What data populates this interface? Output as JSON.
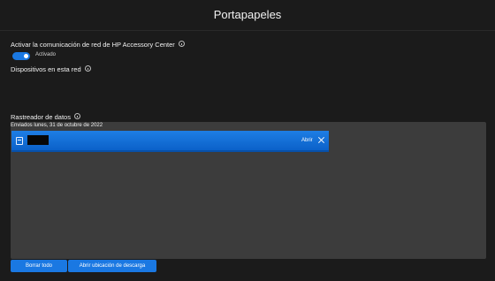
{
  "header": {
    "title": "Portapapeles"
  },
  "network": {
    "label": "Activar la comunicación de red de HP Accessory Center",
    "toggle_state": "Activado",
    "toggle_on": true
  },
  "devices": {
    "label": "Dispositivos en esta red"
  },
  "tracker": {
    "label": "Rastreador de datos",
    "sent_date": "Enviados lunes, 31 de octubre de 2022",
    "item": {
      "open_label": "Abrir"
    }
  },
  "buttons": {
    "clear_all": "Borrar todo",
    "open_download_location": "Abrir ubicación de descarga"
  },
  "colors": {
    "accent": "#1a78e2",
    "background": "#1b1b1b",
    "panel": "#3c3c3c"
  },
  "icons": {
    "info": "info-icon",
    "file": "file-icon",
    "close": "close-icon"
  }
}
